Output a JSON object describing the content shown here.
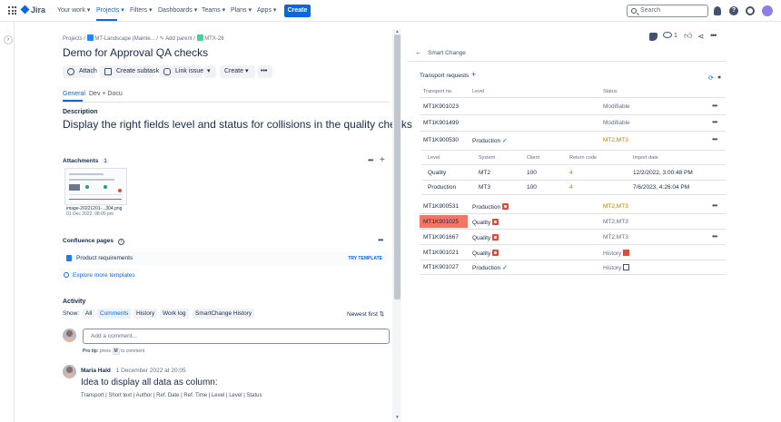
{
  "topnav": {
    "product": "Jira",
    "items": [
      "Your work",
      "Projects",
      "Filters",
      "Dashboards",
      "Teams",
      "Plans",
      "Apps"
    ],
    "create": "Create",
    "search_placeholder": "Search"
  },
  "breadcrumb": {
    "projects": "Projects",
    "project": "MT-Landscape (Mainte...",
    "add_parent": "Add parent",
    "issue_key": "MTX-28"
  },
  "issue": {
    "title": "Demo for Approval QA checks",
    "actions": {
      "attach": "Attach",
      "subtask": "Create subtask",
      "link": "Link issue",
      "create": "Create"
    },
    "tabs": [
      "General",
      "Dev + Docu"
    ],
    "description_label": "Description",
    "description": "Display the right fields level and status for collisions in the quality checks",
    "attachments_label": "Attachments",
    "attachments_count": "1",
    "attachment_name": "image-20221201-...304.png",
    "attachment_date": "01 Dec 2022, 08:05 pm",
    "confluence_label": "Confluence pages",
    "confluence_item": "Product requirements",
    "try_template": "TRY TEMPLATE",
    "explore": "Explore more templates"
  },
  "activity": {
    "label": "Activity",
    "show": "Show:",
    "filters": [
      "All",
      "Comments",
      "History",
      "Work log",
      "SmartChange History"
    ],
    "sort": "Newest first",
    "comment_placeholder": "Add a comment...",
    "pro_tip": "Pro tip:",
    "pro_tip_text": "press",
    "pro_tip_key": "M",
    "pro_tip_end": "to comment",
    "comment_author": "Maria Hald",
    "comment_date": "1 December 2022 at 20:05",
    "comment_heading": "Idea to display all data as column:",
    "comment_body": "Transport | Short text | Author | Ref. Date | Ref. Time | Level | Level | Status"
  },
  "right_header": {
    "watch_count": "1"
  },
  "smartchange": {
    "back_label": "Smart Change",
    "section_title": "Transport requests",
    "columns": [
      "Transport no.",
      "Level",
      "Status"
    ],
    "rows": [
      {
        "no": "MT1K901023",
        "level": "",
        "status": "Modifiable",
        "status_color": "#626f86"
      },
      {
        "no": "MT1K901499",
        "level": "",
        "status": "Modifiable",
        "status_color": "#626f86"
      },
      {
        "no": "MT1K900530",
        "level": "Production",
        "status": "MT2,MT3",
        "status_color": "#b38600"
      }
    ],
    "sub_columns": [
      "Level",
      "System",
      "Client",
      "Return code",
      "Import date"
    ],
    "sub_rows": [
      {
        "level": "Quality",
        "system": "MT2",
        "client": "100",
        "rc": "4",
        "date": "12/2/2022, 3:00:48 PM"
      },
      {
        "level": "Production",
        "system": "MT3",
        "client": "100",
        "rc": "4",
        "date": "7/6/2023, 4:26:04 PM"
      }
    ],
    "rows2": [
      {
        "no": "MT1K900531",
        "level": "Production",
        "status": "MT2,MT3",
        "status_color": "#b38600"
      },
      {
        "no": "MT1K901025",
        "level": "Quality",
        "status": "MT2,MT3",
        "status_color": "#626f86"
      },
      {
        "no": "MT1K901667",
        "level": "Quality",
        "status": "MT2,MT3",
        "status_color": "#626f86"
      },
      {
        "no": "MT1K901021",
        "level": "Quality",
        "status": "History",
        "status_color": "#626f86"
      },
      {
        "no": "MT1K901027",
        "level": "Production",
        "status": "History",
        "status_color": "#626f86"
      }
    ],
    "highlight_color": "#f87462"
  }
}
